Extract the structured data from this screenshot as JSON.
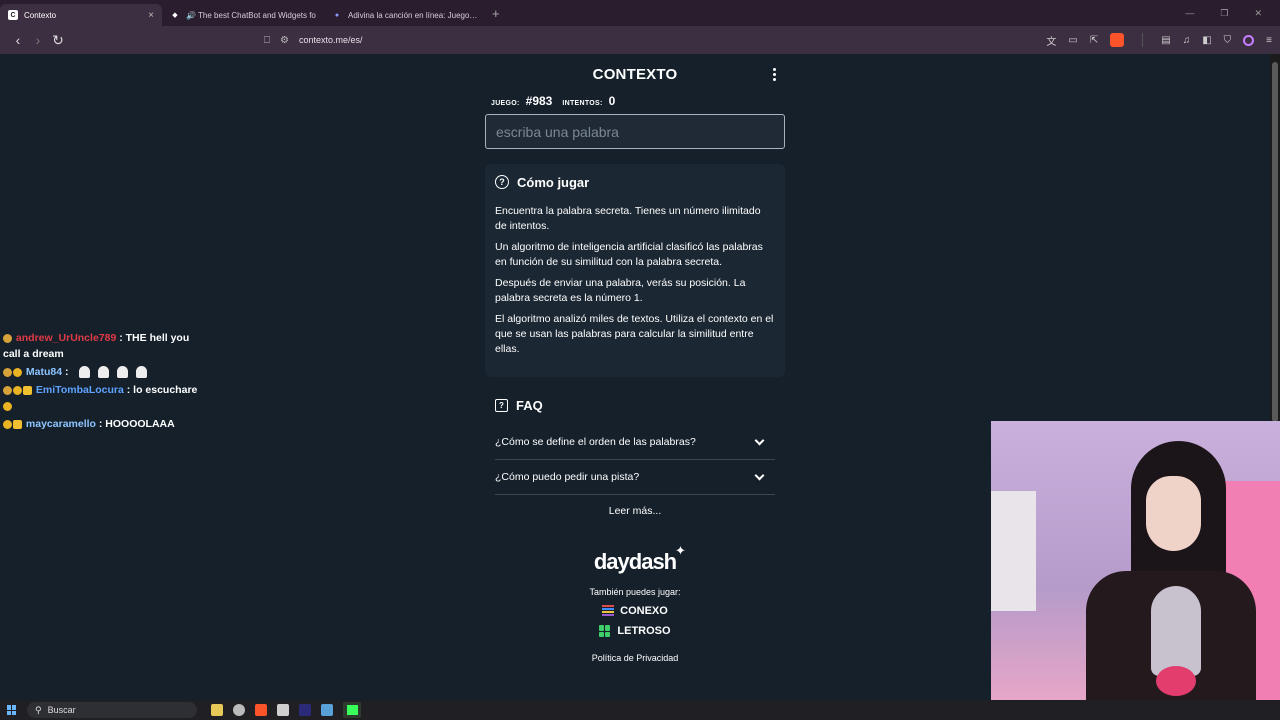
{
  "browser": {
    "tabs": [
      {
        "label": "Contexto",
        "fav_letter": "C",
        "fav_color": "#ffffff",
        "active": true
      },
      {
        "label": "🔊 The best ChatBot and Widgets fo",
        "fav_letter": "◆",
        "fav_color": "#ffffff",
        "active": false
      },
      {
        "label": "Adivina la canción en línea: Juegos d",
        "fav_letter": "●",
        "fav_color": "#8a9cff",
        "active": false
      }
    ],
    "url": "contexto.me/es/"
  },
  "game": {
    "title": "CONTEXTO",
    "game_label": "JUEGO:",
    "game_number": "#983",
    "attempts_label": "INTENTOS:",
    "attempts_value": "0",
    "input_placeholder": "escriba una palabra"
  },
  "how_to": {
    "title": "Cómo jugar",
    "paragraphs": [
      "Encuentra la palabra secreta. Tienes un número ilimitado de intentos.",
      "Un algoritmo de inteligencia artificial clasificó las palabras en función de su similitud con la palabra secreta.",
      "Después de enviar una palabra, verás su posición. La palabra secreta es la número 1.",
      "El algoritmo analizó miles de textos. Utiliza el contexto en el que se usan las palabras para calcular la similitud entre ellas."
    ]
  },
  "faq": {
    "title": "FAQ",
    "items": [
      "¿Cómo se define el orden de las palabras?",
      "¿Cómo puedo pedir una pista?"
    ],
    "read_more": "Leer más..."
  },
  "footer": {
    "brand": "daydash",
    "also_play": "También puedes jugar:",
    "games": [
      "CONEXO",
      "LETROSO"
    ],
    "privacy": "Política de Privacidad"
  },
  "chat": {
    "messages": [
      {
        "user": "andrew_UrUncle789",
        "text": ": THE hell you call a dream",
        "user_color": "#e03a45"
      },
      {
        "user": "Matu84",
        "text": ":",
        "user_color": "#8ec5ff"
      },
      {
        "user": "EmiTombaLocura",
        "text": ": lo escuchare",
        "user_color": "#5fa3ff"
      },
      {
        "user": "maycaramello",
        "text": ": HOOOOLAAA",
        "user_color": "#8ec5ff"
      }
    ]
  },
  "taskbar": {
    "search_label": "Buscar"
  }
}
